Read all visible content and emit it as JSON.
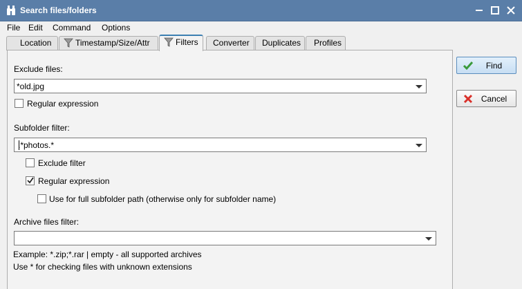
{
  "window": {
    "title": "Search files/folders"
  },
  "menu": [
    "File",
    "Edit",
    "Command",
    "Options"
  ],
  "tabs": [
    "Location",
    "Timestamp/Size/Attr",
    "Filters",
    "Converter",
    "Duplicates",
    "Profiles"
  ],
  "active_tab": "Filters",
  "filters": {
    "exclude_files_label": "Exclude files:",
    "exclude_files_value": "*old.jpg",
    "exclude_regex_label": "Regular expression",
    "exclude_regex_checked": false,
    "subfolder_label": "Subfolder filter:",
    "subfolder_value": ".*photos.*",
    "subfolder_exclude_label": "Exclude filter",
    "subfolder_exclude_checked": false,
    "subfolder_regex_label": "Regular expression",
    "subfolder_regex_checked": true,
    "full_path_label": "Use for full subfolder path (otherwise only for subfolder name)",
    "full_path_checked": false,
    "archive_label": "Archive files filter:",
    "archive_value": "",
    "archive_example": "Example: *.zip;*.rar | empty - all supported archives",
    "archive_hint": "Use * for checking files with unknown extensions"
  },
  "buttons": {
    "find": "Find",
    "cancel": "Cancel"
  },
  "colors": {
    "titlebar": "#5a7ea8",
    "accent": "#3c7fb1",
    "find_icon": "#3a9a3a",
    "cancel_icon": "#d9302a"
  }
}
